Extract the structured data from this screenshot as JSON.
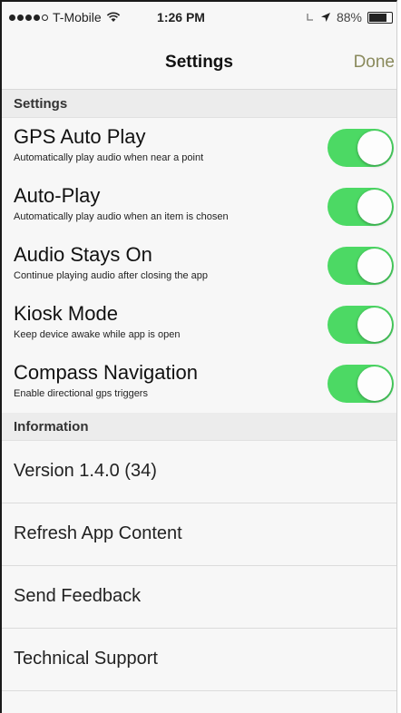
{
  "status_bar": {
    "carrier": "T-Mobile",
    "time": "1:26 PM",
    "battery": "88%",
    "battery_level": 0.88,
    "signal_bars_filled": 4
  },
  "nav": {
    "title": "Settings",
    "done_label": "Done"
  },
  "settings_section": {
    "header": "Settings",
    "items": [
      {
        "label": "GPS Auto Play",
        "description": "Automatically play audio when near a point",
        "enabled": true
      },
      {
        "label": "Auto-Play",
        "description": "Automatically play audio when an item is chosen",
        "enabled": true
      },
      {
        "label": "Audio Stays On",
        "description": "Continue playing audio after closing the app",
        "enabled": true
      },
      {
        "label": "Kiosk Mode",
        "description": "Keep device awake while app is open",
        "enabled": true
      },
      {
        "label": "Compass Navigation",
        "description": "Enable directional gps triggers",
        "enabled": true
      }
    ]
  },
  "information_section": {
    "header": "Information",
    "items": [
      {
        "label": "Version 1.4.0 (34)"
      },
      {
        "label": "Refresh App Content"
      },
      {
        "label": "Send Feedback"
      },
      {
        "label": "Technical Support"
      }
    ]
  },
  "colors": {
    "switch_on": "#4cd964",
    "done_text": "#8a8a5c"
  }
}
